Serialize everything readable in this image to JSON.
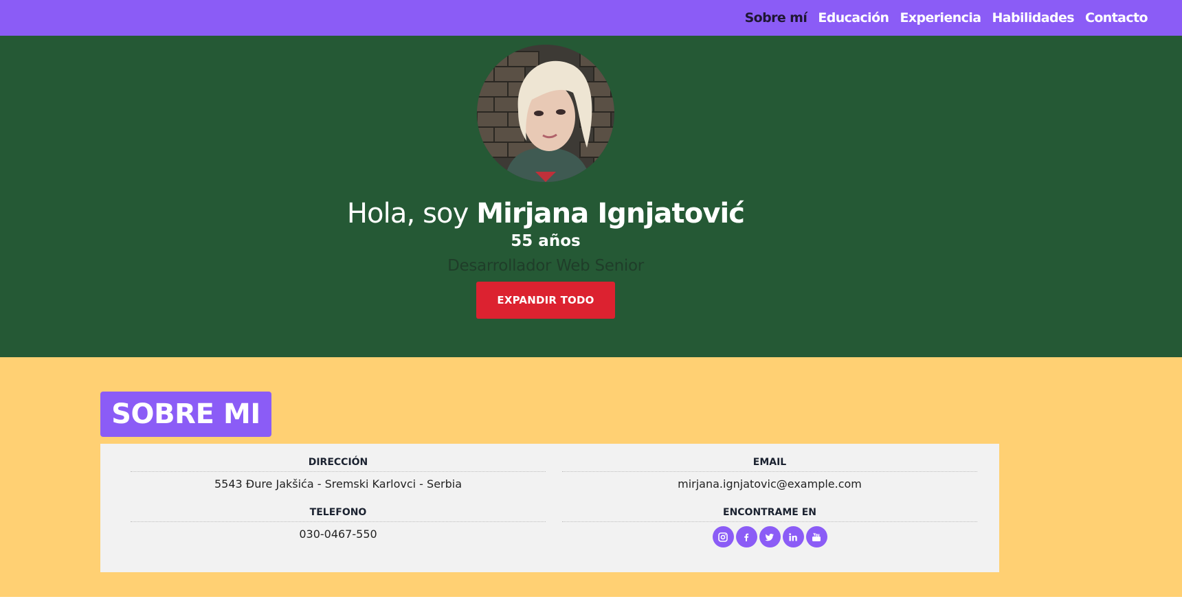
{
  "nav": {
    "items": [
      {
        "label": "Sobre mí"
      },
      {
        "label": "Educación"
      },
      {
        "label": "Experiencia"
      },
      {
        "label": "Habilidades"
      },
      {
        "label": "Contacto"
      }
    ]
  },
  "hero": {
    "greeting": "Hola, soy ",
    "name": "Mirjana Ignjatović",
    "age": "55 años",
    "role": "Desarrollador Web Senior",
    "expand_label": "EXPANDIR TODO"
  },
  "about": {
    "title": "SOBRE MI",
    "address_label": "DIRECCIÓN",
    "address_value": "5543 Đure Jakšića - Sremski Karlovci - Serbia",
    "email_label": "EMAIL",
    "email_value": "mirjana.ignjatovic@example.com",
    "phone_label": "TELEFONO",
    "phone_value": "030-0467-550",
    "social_label": "ENCONTRAME EN",
    "social_icons": [
      "instagram-icon",
      "facebook-icon",
      "twitter-icon",
      "linkedin-icon",
      "youtube-icon"
    ]
  },
  "colors": {
    "navbar": "#8b5cf6",
    "hero_bg": "#255935",
    "page_bg": "#ffd073",
    "button": "#dc2230",
    "card_bg": "#f2f2f2"
  }
}
